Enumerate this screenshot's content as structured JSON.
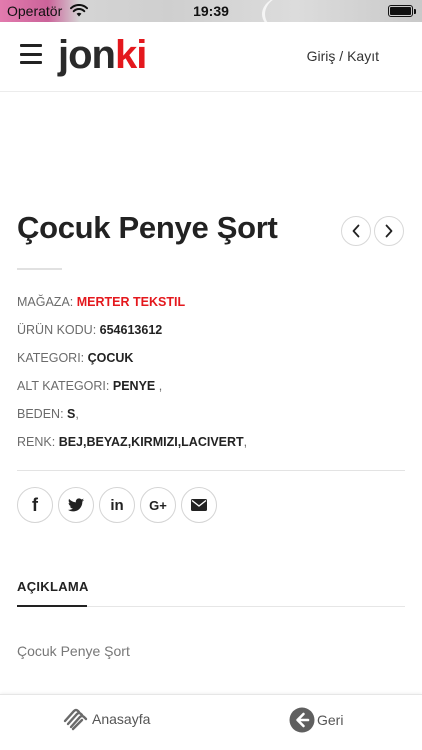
{
  "status_bar": {
    "carrier": "Operatör",
    "time": "19:39"
  },
  "header": {
    "logo_left": "jon",
    "logo_right": "ki",
    "login_label": "Giriş / Kayıt"
  },
  "product": {
    "title": "Çocuk Penye Şort",
    "meta": {
      "store_label": "MAĞAZA:",
      "store_value": "MERTER TEKSTIL",
      "code_label": "ÜRÜN KODU:",
      "code_value": "654613612",
      "category_label": "KATEGORI:",
      "category_value": "ÇOCUK",
      "subcategory_label": "ALT KATEGORI:",
      "subcategory_value": "PENYE",
      "subcategory_suffix": " ,",
      "size_label": "BEDEN:",
      "size_value": "S",
      "size_suffix": ",",
      "color_label": "RENK:",
      "color_value": "BEJ,BEYAZ,KIRMIZI,LACIVERT",
      "color_suffix": ","
    }
  },
  "social": [
    {
      "name": "facebook-icon",
      "glyph": "f"
    },
    {
      "name": "twitter-icon",
      "glyph": "t"
    },
    {
      "name": "linkedin-icon",
      "glyph": "in"
    },
    {
      "name": "google-plus-icon",
      "glyph": "G+"
    },
    {
      "name": "email-icon",
      "glyph": "✉"
    }
  ],
  "tabs": {
    "description_label": "AÇIKLAMA"
  },
  "description": {
    "text": "Çocuk Penye Şort"
  },
  "bottom_nav": {
    "home_label": "Anasayfa",
    "back_label": "Geri"
  },
  "colors": {
    "brand_red": "#e4181d",
    "text_dark": "#222222",
    "text_muted": "#6b6b6b"
  }
}
